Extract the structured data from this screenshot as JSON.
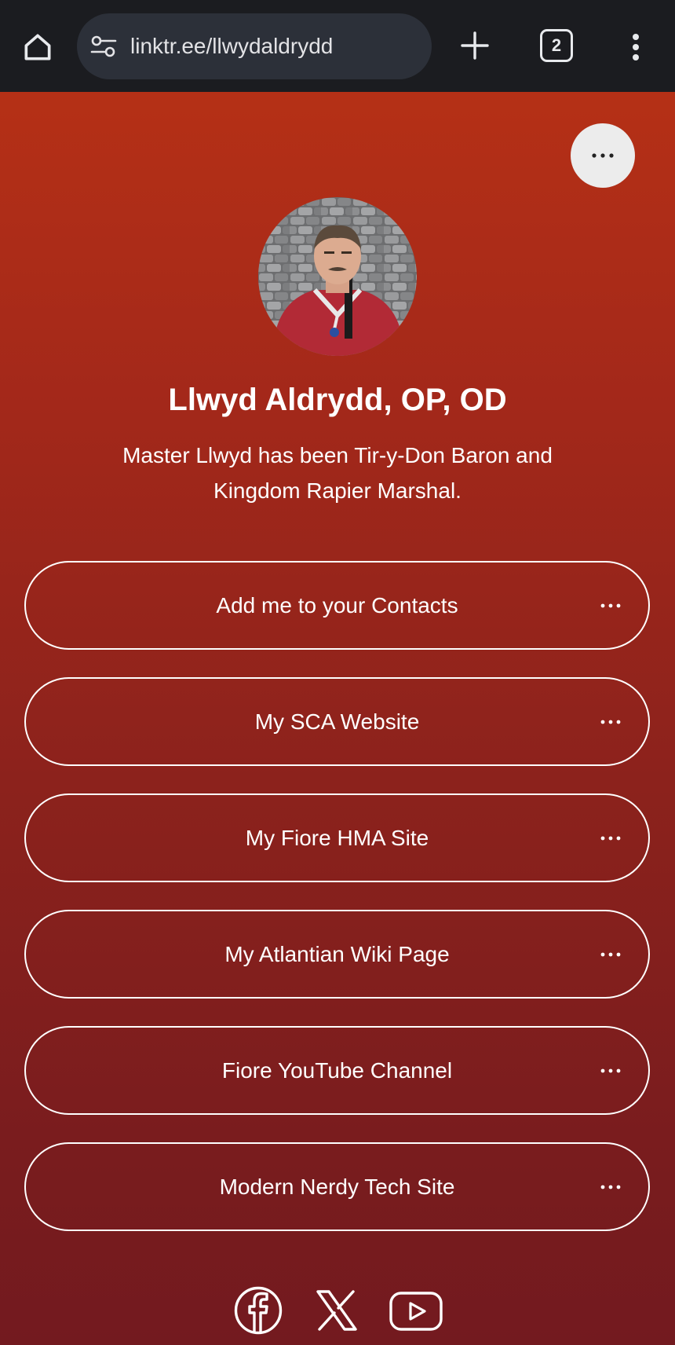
{
  "browser": {
    "url": "linktr.ee/llwydaldrydd",
    "tab_count": "2",
    "icons": {
      "home": "home-icon",
      "site_settings": "tune-icon",
      "new_tab": "plus-icon",
      "tabs": "tab-switcher-icon",
      "menu": "more-vert-icon"
    }
  },
  "profile": {
    "name": "Llwyd Aldrydd, OP, OD",
    "bio_line1": "Master Llwyd has been Tir-y-Don Baron and",
    "bio_line2": "Kingdom Rapier Marshal."
  },
  "links": [
    {
      "label": "Add me to your Contacts"
    },
    {
      "label": "My SCA Website"
    },
    {
      "label": "My Fiore HMA Site"
    },
    {
      "label": "My Atlantian Wiki Page"
    },
    {
      "label": "Fiore YouTube Channel"
    },
    {
      "label": "Modern Nerdy Tech Site"
    }
  ],
  "socials": [
    "facebook-icon",
    "x-icon",
    "youtube-icon"
  ],
  "colors": {
    "page_top": "#b53016",
    "page_bottom": "#731a1f",
    "chrome": "#1b1c20",
    "urlbar": "#2c3039"
  }
}
